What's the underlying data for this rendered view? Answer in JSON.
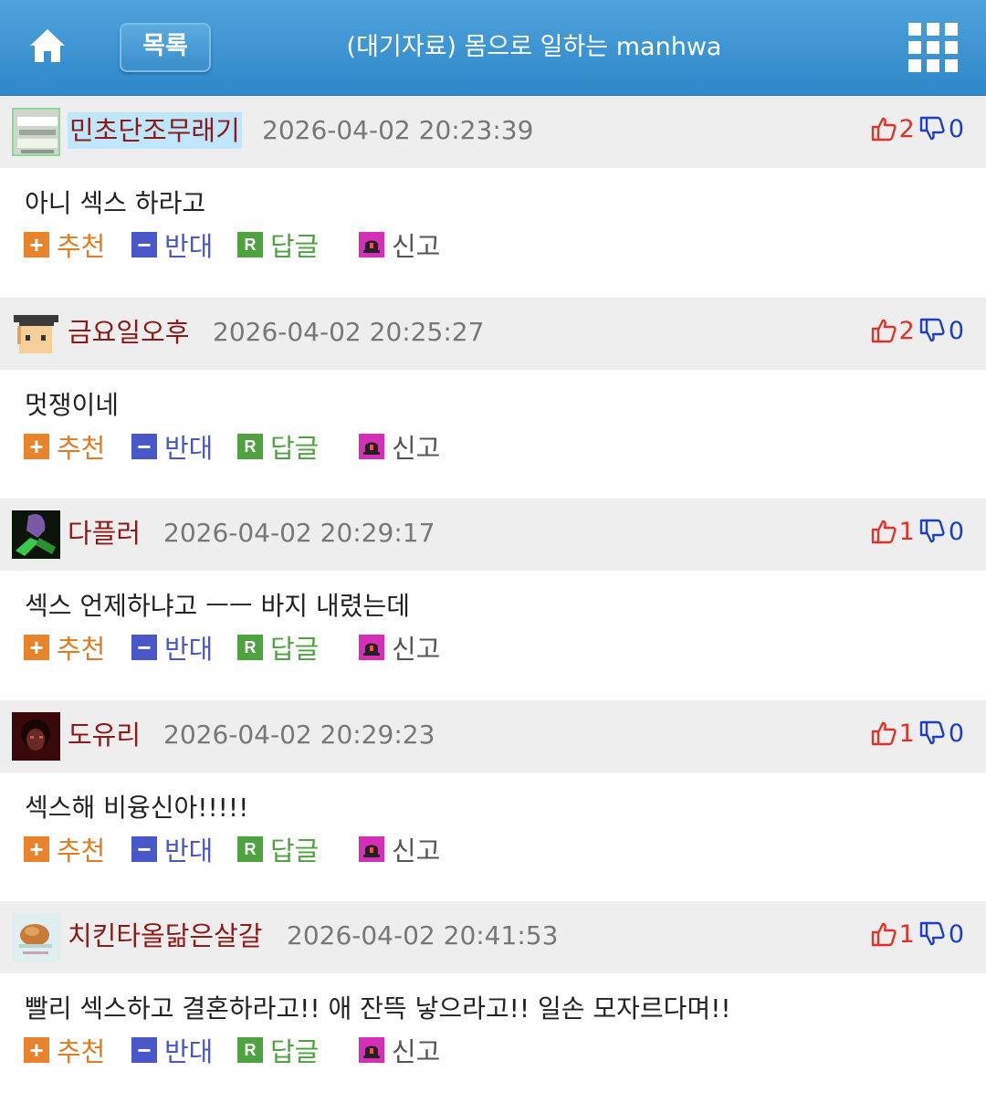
{
  "header": {
    "home_icon": "home-icon",
    "list_label": "목록",
    "title": "(대기자료) 몸으로 일하는 manhwa",
    "menu_icon": "grid-menu-icon"
  },
  "actions": {
    "recommend": "추천",
    "oppose": "반대",
    "reply": "답글",
    "report": "신고",
    "recommend_icon_glyph": "+",
    "oppose_icon_glyph": "−",
    "reply_icon_glyph": "R"
  },
  "comments": [
    {
      "nick": "민초단조무래기",
      "date": "2026-04-02 20:23:39",
      "up": "2",
      "down": "0",
      "text": "아니 섹스 하라고"
    },
    {
      "nick": "금요일오후",
      "date": "2026-04-02 20:25:27",
      "up": "2",
      "down": "0",
      "text": "멋쟁이네"
    },
    {
      "nick": "다플러",
      "date": "2026-04-02 20:29:17",
      "up": "1",
      "down": "0",
      "text": "섹스 언제하냐고 ㅡㅡ 바지 내렸는데"
    },
    {
      "nick": "도유리",
      "date": "2026-04-02 20:29:23",
      "up": "1",
      "down": "0",
      "text": "섹스해 비융신아!!!!!"
    },
    {
      "nick": "치킨타올닮은살갈",
      "date": "2026-04-02 20:41:53",
      "up": "1",
      "down": "0",
      "text": "빨리 섹스하고 결혼하라고!! 애 잔뜩 낳으라고!! 일손 모자르다며!!"
    }
  ],
  "colors": {
    "header_blue": "#3a8dcc",
    "nick": "#8b1a1a",
    "up": "#e0312c",
    "down": "#1e3ec9",
    "recommend": "#e8822c",
    "oppose": "#4a57c8",
    "reply": "#4ea23f",
    "report": "#d62fb7"
  }
}
